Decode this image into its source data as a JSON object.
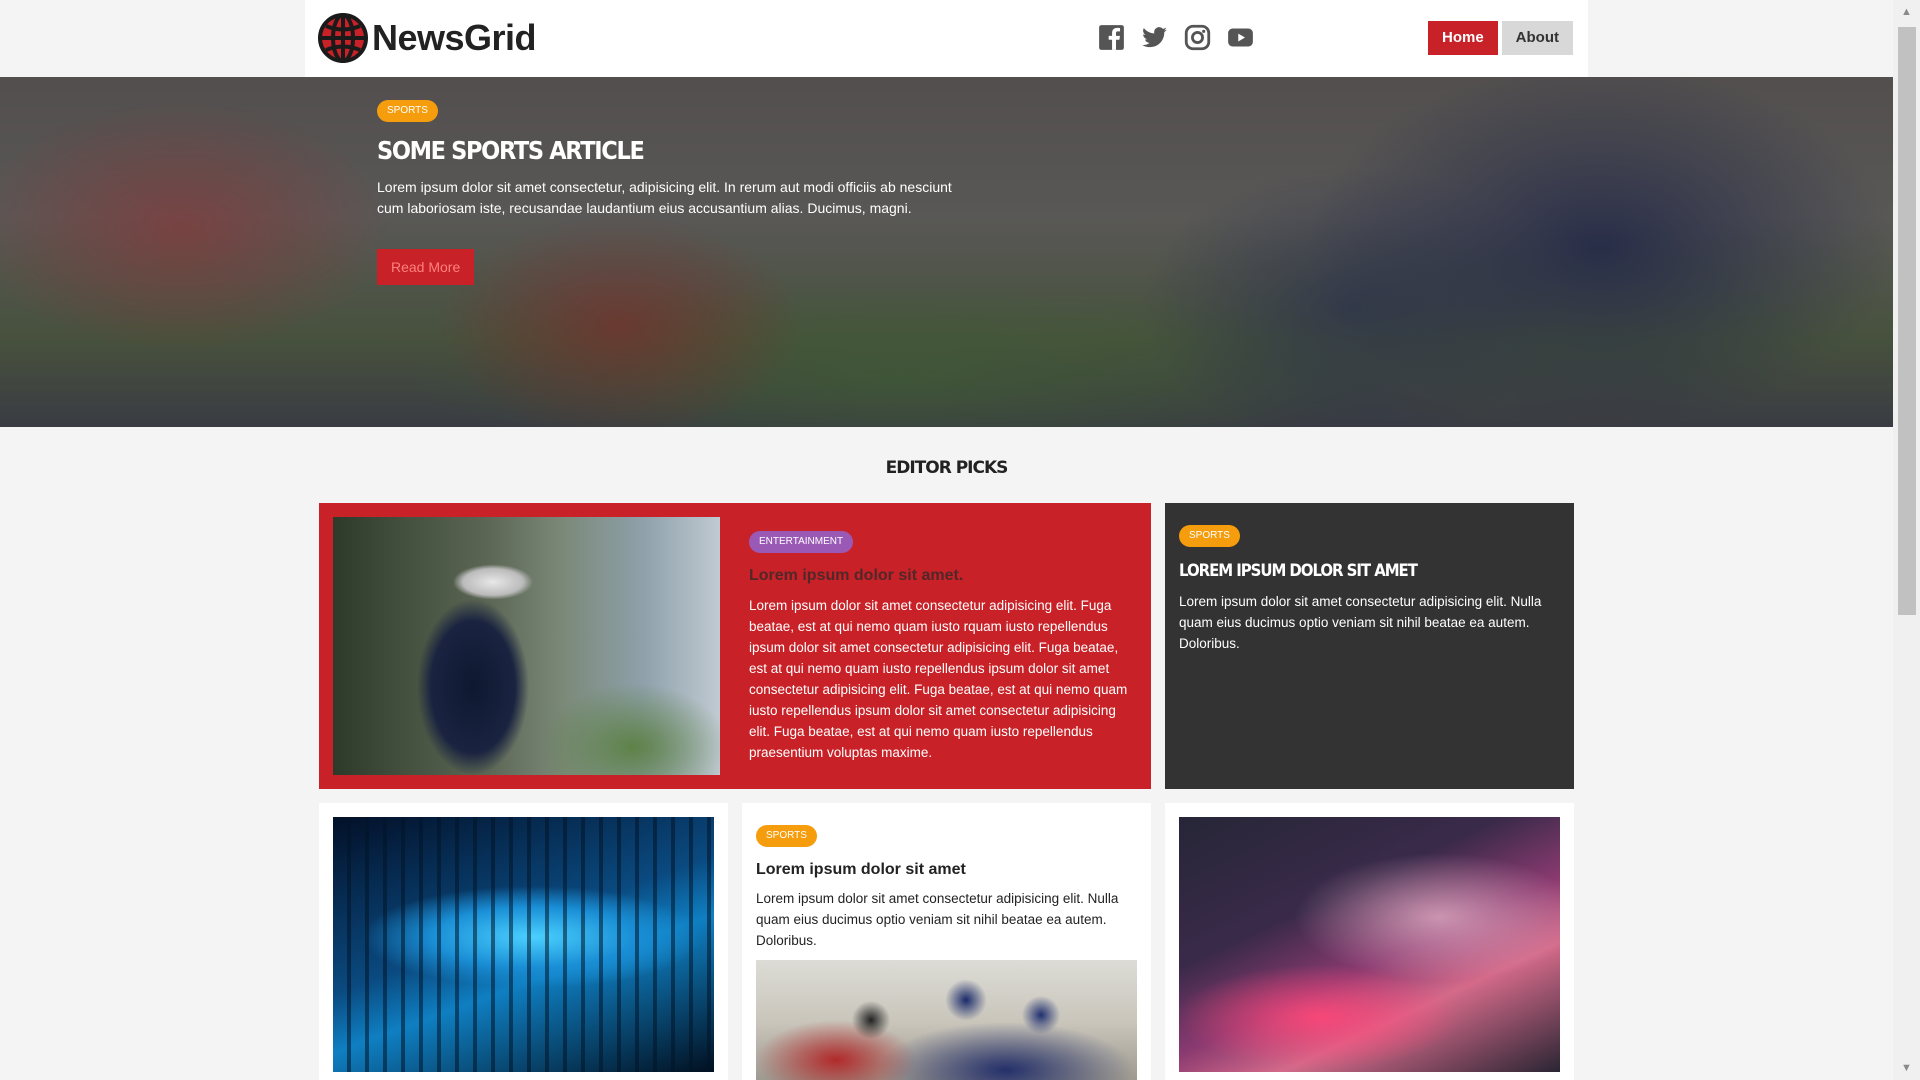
{
  "header": {
    "logo_text": "NewsGrid",
    "social": [
      {
        "icon": "facebook-icon"
      },
      {
        "icon": "twitter-icon"
      },
      {
        "icon": "instagram-icon"
      },
      {
        "icon": "youtube-icon"
      }
    ],
    "nav": {
      "home": "Home",
      "about": "About"
    }
  },
  "hero": {
    "badge": "SPORTS",
    "title": "SOME SPORTS ARTICLE",
    "text": "Lorem ipsum dolor sit amet consectetur, adipisicing elit. In rerum aut modi officiis ab nesciunt cum laboriosam iste, recusandae laudantium eius accusantium alias. Ducimus, magni.",
    "button": "Read More"
  },
  "editor_picks": {
    "title": "EDITOR PICKS",
    "featured": {
      "badge": "ENTERTAINMENT",
      "title": "Lorem ipsum dolor sit amet.",
      "text": "Lorem ipsum dolor sit amet consectetur adipisicing elit. Fuga beatae, est at qui nemo quam iusto rquam iusto repellendus ipsum dolor sit amet consectetur adipisicing elit. Fuga beatae, est at qui nemo quam iusto repellendus ipsum dolor sit amet consectetur adipisicing elit. Fuga beatae, est at qui nemo quam iusto repellendus ipsum dolor sit amet consectetur adipisicing elit. Fuga beatae, est at qui nemo quam iusto repellendus praesentium voluptas maxime."
    },
    "side": {
      "badge": "SPORTS",
      "title": "LOREM IPSUM DOLOR SIT AMET",
      "text": "Lorem ipsum dolor sit amet consectetur adipisicing elit. Nulla quam eius ducimus optio veniam sit nihil beatae ea autem. Doloribus."
    },
    "middle": {
      "badge": "SPORTS",
      "title": "Lorem ipsum dolor sit amet",
      "text": "Lorem ipsum dolor sit amet consectetur adipisicing elit. Nulla quam eius ducimus optio veniam sit nihil beatae ea autem. Doloribus."
    }
  },
  "colors": {
    "accent": "#c82127",
    "sports": "#f59d0d",
    "entertainment": "#9a59b5",
    "dark_card": "#333333"
  }
}
